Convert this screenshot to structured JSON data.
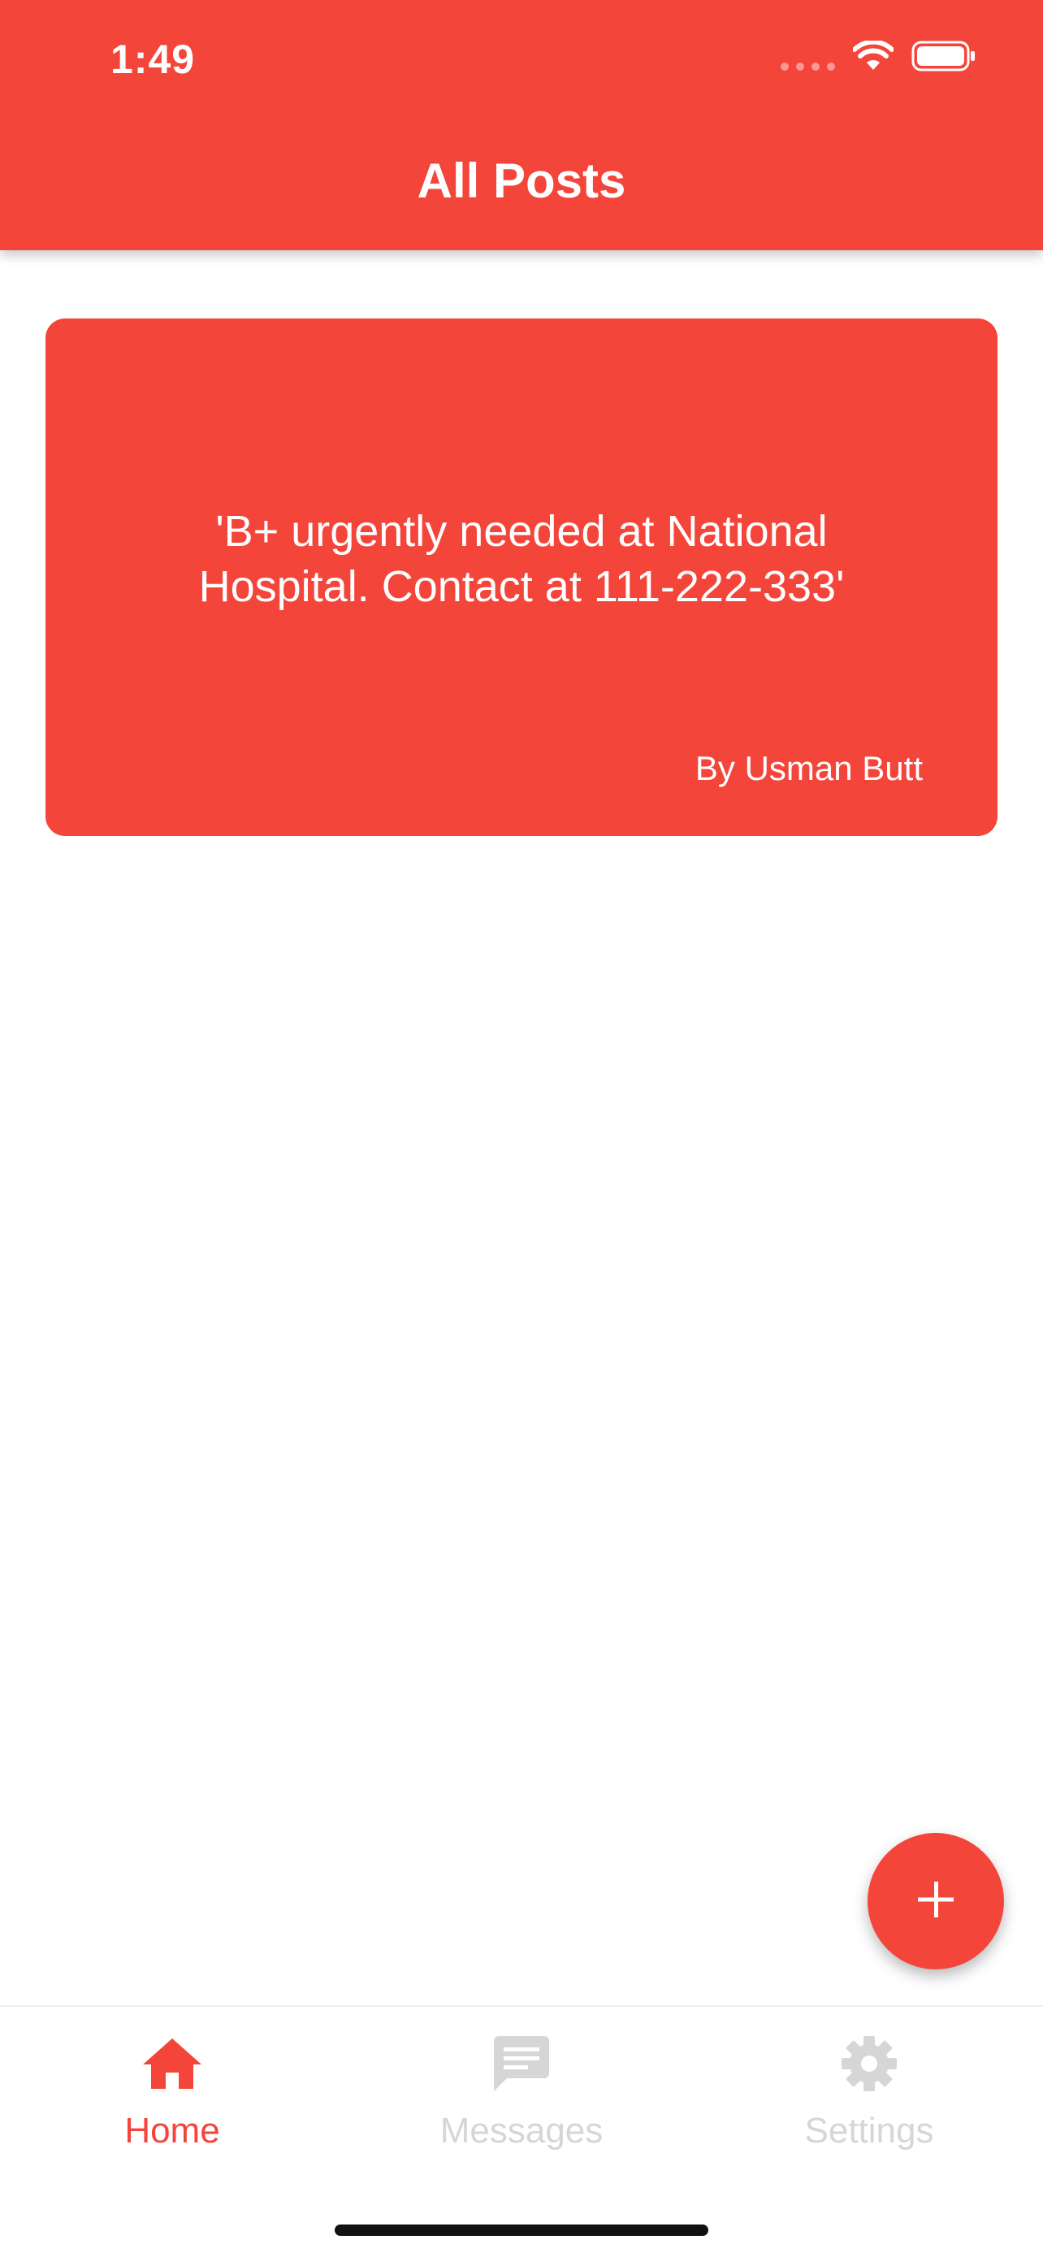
{
  "status_bar": {
    "time": "1:49",
    "wifi_icon": "wifi-icon",
    "battery_icon": "battery-icon",
    "signal_icon": "signal-dots-icon"
  },
  "header": {
    "title": "All Posts"
  },
  "posts": [
    {
      "text": "'B+ urgently needed at National Hospital. Contact at 111-222-333'",
      "author": "By Usman Butt"
    }
  ],
  "fab": {
    "icon": "plus-icon"
  },
  "bottom_nav": {
    "items": [
      {
        "label": "Home",
        "icon": "home-icon",
        "active": true
      },
      {
        "label": "Messages",
        "icon": "chat-icon",
        "active": false
      },
      {
        "label": "Settings",
        "icon": "gear-icon",
        "active": false
      }
    ]
  },
  "colors": {
    "primary": "#f4453a",
    "inactive": "#d6d6d6",
    "background": "#ffffff"
  }
}
